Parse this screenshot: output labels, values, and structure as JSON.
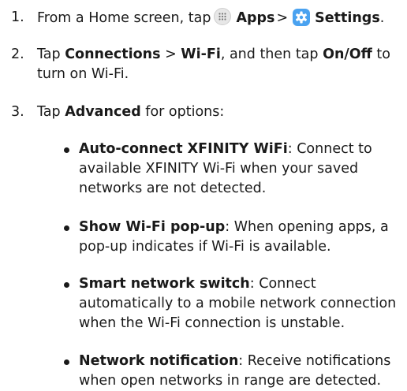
{
  "steps": [
    {
      "number": "1.",
      "prefix": "From a Home screen, tap",
      "apps_label": "Apps",
      "separator": ">",
      "settings_label": "Settings",
      "suffix": "."
    },
    {
      "number": "2.",
      "t1": "Tap ",
      "connections": "Connections",
      "sep": " > ",
      "wifi": "Wi-Fi",
      "t2": ", and then tap ",
      "onoff": "On/Off",
      "t3": " to turn on Wi-Fi."
    },
    {
      "number": "3.",
      "t1": "Tap ",
      "advanced": "Advanced",
      "t2": " for options:"
    }
  ],
  "options": [
    {
      "title": "Auto-connect XFINITY WiFi",
      "description": ": Connect to available XFINITY Wi-Fi when your saved networks are not detected."
    },
    {
      "title": "Show Wi-Fi pop-up",
      "description": ": When opening apps, a pop-up indicates if Wi-Fi is available."
    },
    {
      "title": "Smart network switch",
      "description": ": Connect automatically to a mobile network connection when the Wi-Fi connection is unstable."
    },
    {
      "title": "Network notification",
      "description": ": Receive notifications when open networks in range are detected."
    }
  ],
  "icons": {
    "apps": "apps-grid-icon",
    "settings": "settings-gear-icon",
    "settings_color": "#4aa2f0"
  }
}
